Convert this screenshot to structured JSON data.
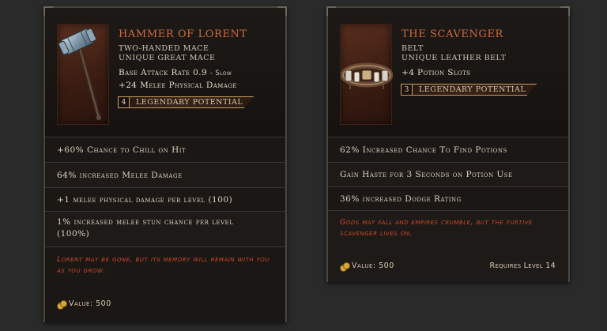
{
  "items": [
    {
      "name": "Hammer of Lorent",
      "type_line": "Two-Handed Mace",
      "rarity_line": "Unique Great Mace",
      "base_attack_label": "Base Attack Rate",
      "base_attack_value": "0.9",
      "base_attack_speed": "- Slow",
      "implicit": "+24 Melee Physical Damage",
      "legendary_potential": "4",
      "legendary_label": "Legendary Potential",
      "affixes": [
        "+60% Chance to Chill on Hit",
        "64% increased Melee Damage",
        "+1 melee physical damage per level (100)",
        "1% increased melee stun chance per level (100%)"
      ],
      "lore": "Lorent may be gone, but its memory will remain with you as you grow.",
      "value": "Value: 500",
      "icon": "hammer-icon"
    },
    {
      "name": "The Scavenger",
      "type_line": "Belt",
      "rarity_line": "Unique Leather Belt",
      "implicit": "+4 Potion Slots",
      "legendary_potential": "3",
      "legendary_label": "Legendary Potential",
      "affixes": [
        "62% Increased Chance To Find Potions",
        "Gain Haste for 3 Seconds on Potion Use",
        "36% increased Dodge Rating"
      ],
      "lore": "Gods may fall and empires crumble, but the furtive scavenger lives on.",
      "value": "Value: 500",
      "requirement": "Requires Level 14",
      "icon": "belt-icon"
    }
  ],
  "colors": {
    "name": "#d06a3c",
    "lore": "#c9482a",
    "legendary_border": "#c8a060"
  }
}
